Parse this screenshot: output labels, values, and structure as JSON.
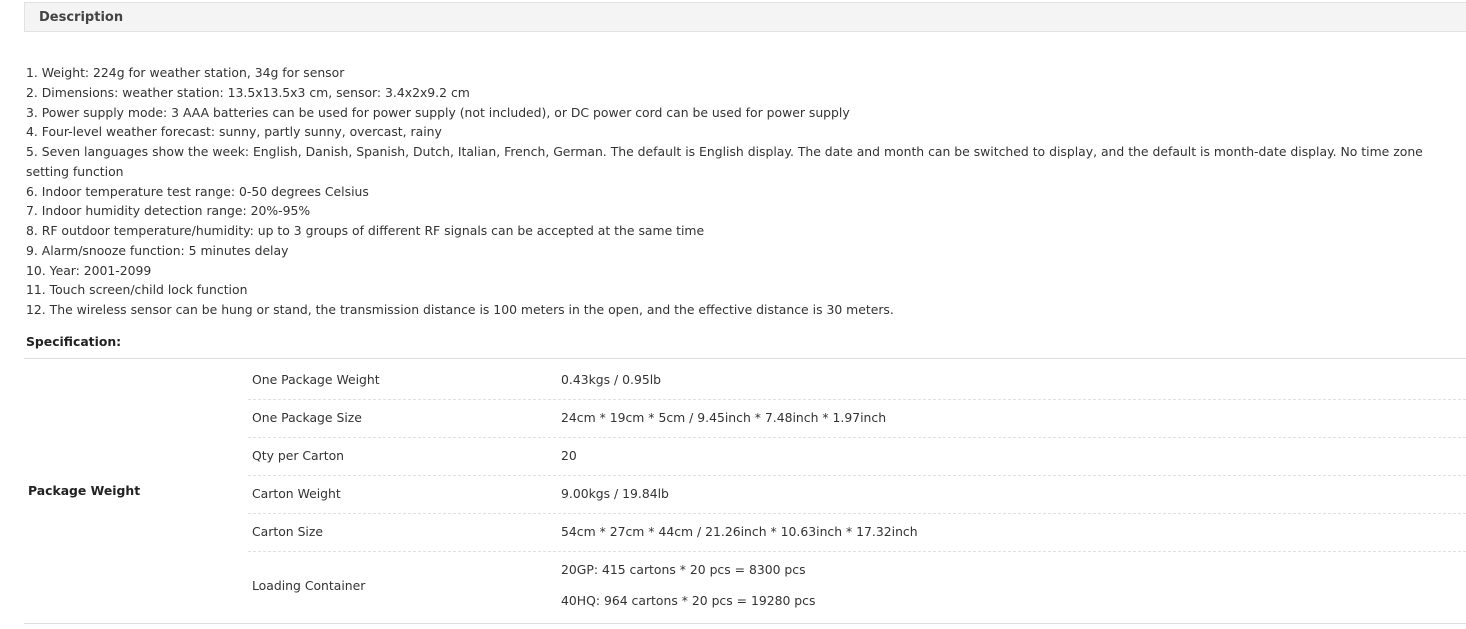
{
  "tab": {
    "title": "Description"
  },
  "description": {
    "items": [
      "1. Weight: 224g for weather station, 34g for sensor",
      "2. Dimensions: weather station: 13.5x13.5x3 cm, sensor: 3.4x2x9.2 cm",
      "3. Power supply mode: 3 AAA batteries can be used for power supply (not included), or DC power cord can be used for power supply",
      "4. Four-level weather forecast: sunny, partly sunny, overcast, rainy",
      "5. Seven languages show the week: English, Danish, Spanish, Dutch, Italian, French, German. The default is English display. The date and month can be switched to display, and the default is month-date display. No time zone setting function",
      "6. Indoor temperature test range: 0-50 degrees Celsius",
      "7. Indoor humidity detection range: 20%-95%",
      "8. RF outdoor temperature/humidity: up to 3 groups of different RF signals can be accepted at the same time",
      "9. Alarm/snooze function: 5 minutes delay",
      "10. Year: 2001-2099",
      "11. Touch screen/child lock function",
      "12. The wireless sensor can be hung or stand, the transmission distance is 100 meters in the open, and the effective distance is 30 meters."
    ]
  },
  "specification": {
    "heading": "Specification:",
    "group_label": "Package Weight",
    "rows": [
      {
        "key": "One Package Weight",
        "value": "0.43kgs / 0.95lb"
      },
      {
        "key": "One Package Size",
        "value": "24cm * 19cm * 5cm / 9.45inch * 7.48inch * 1.97inch"
      },
      {
        "key": "Qty per Carton",
        "value": "20"
      },
      {
        "key": "Carton Weight",
        "value": "9.00kgs / 19.84lb"
      },
      {
        "key": "Carton Size",
        "value": "54cm * 27cm * 44cm / 21.26inch * 10.63inch * 17.32inch"
      },
      {
        "key": "Loading Container",
        "value": "20GP: 415 cartons * 20 pcs = 8300 pcs",
        "value2": "40HQ: 964 cartons * 20 pcs = 19280 pcs"
      }
    ]
  }
}
